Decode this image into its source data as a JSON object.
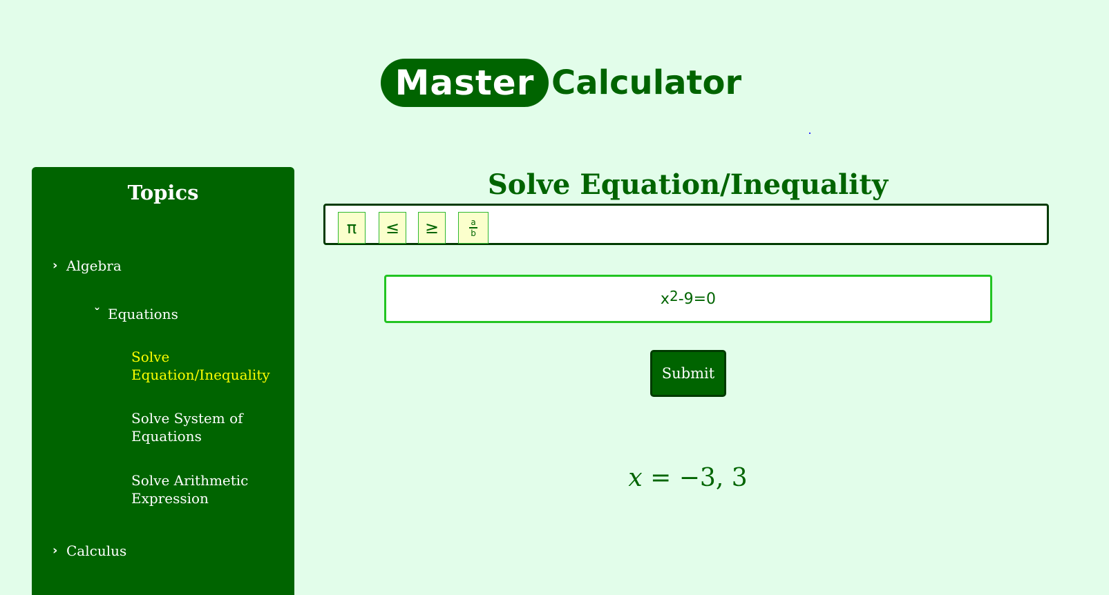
{
  "brand": {
    "pill_text": "Master",
    "text": "Calculator"
  },
  "sidebar": {
    "title": "Topics",
    "algebra_label": "Algebra",
    "equations_label": "Equations",
    "leaves": [
      {
        "label": "Solve Equation/Inequality",
        "active": true
      },
      {
        "label": "Solve System of Equations",
        "active": false
      },
      {
        "label": "Solve Arithmetic Expression",
        "active": false
      }
    ],
    "calculus_label": "Calculus"
  },
  "main": {
    "heading": "Solve Equation/Inequality",
    "symbols": {
      "pi": "π",
      "le": "≤",
      "ge": "≥",
      "frac_num": "a",
      "frac_den": "b"
    },
    "input": {
      "base": "x",
      "exponent": "2",
      "rest": "-9=0"
    },
    "submit_label": "Submit",
    "result": {
      "variable": "x",
      "rhs": "= −3, 3"
    }
  },
  "colors": {
    "background": "#e2fdea",
    "primary": "#006400",
    "active_link": "#ffff00",
    "input_border": "#22c422",
    "symbol_bg": "#fbffcc"
  }
}
